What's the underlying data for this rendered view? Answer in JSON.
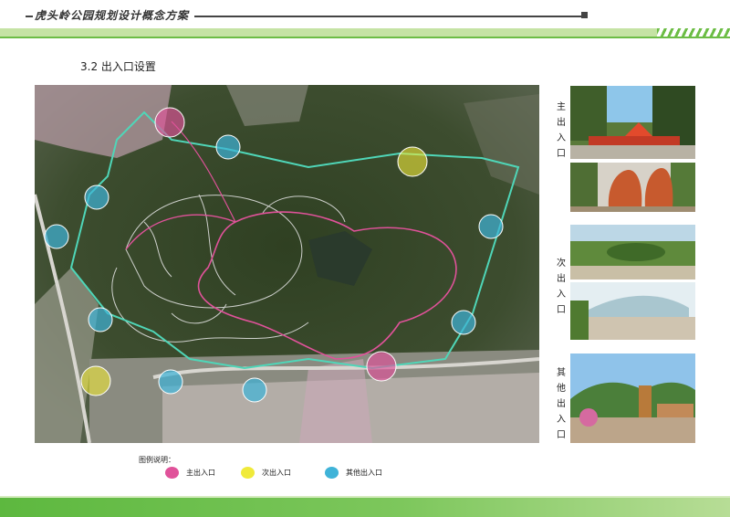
{
  "header": {
    "title": "虎头岭公园规划设计概念方案"
  },
  "section": {
    "title": "3.2 出入口设置"
  },
  "side_labels": {
    "main": "主\n出\n入\n口",
    "secondary": "次\n出\n入\n口",
    "other": "其\n他\n出\n入\n口"
  },
  "legend": {
    "title": "图例说明：",
    "items": [
      {
        "label": "主出入口",
        "color": "#e0529a"
      },
      {
        "label": "次出入口",
        "color": "#f0ea3a"
      },
      {
        "label": "其他出入口",
        "color": "#3fb3d8"
      }
    ]
  },
  "colors": {
    "accent_green": "#6cbd45",
    "boundary": "#4fd6b8",
    "main_loop": "#e0529a",
    "paths": "#e8e8e8"
  }
}
